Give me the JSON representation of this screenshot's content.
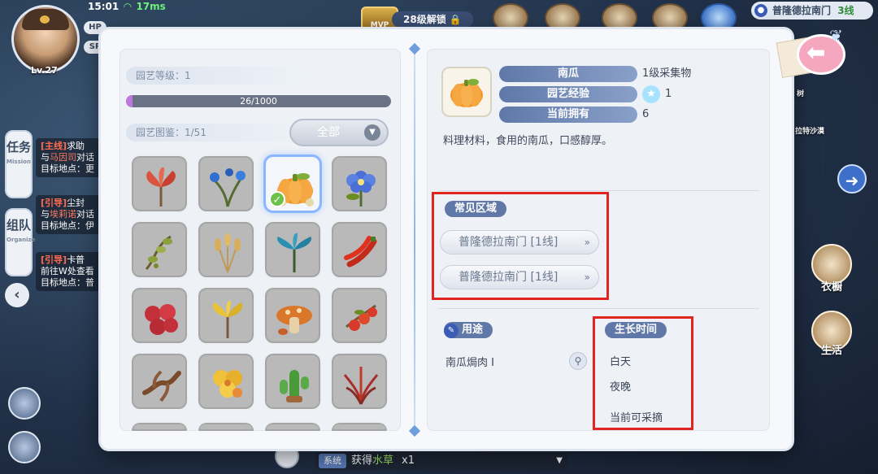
{
  "hud": {
    "time": "15:01",
    "ping": "17ms",
    "level": "Lv.27",
    "hp_label": "HP",
    "sp_label": "SP",
    "mvp_label": "MVP",
    "unlock_badge": "28级解锁",
    "location": "普隆德拉南门",
    "location_line": "3线",
    "mission_tab": "任务",
    "mission_sub": "Mission",
    "team_tab": "组队",
    "team_sub": "Organize",
    "quests": [
      {
        "tag": "[主线]",
        "title": "求助",
        "line2_pre": "与",
        "line2_hl": "马因司",
        "line2_post": "对话",
        "line3": "目标地点：更"
      },
      {
        "tag": "[引导]",
        "title": "尘封",
        "line2_pre": "与",
        "line2_hl": "埃莉诺",
        "line2_post": "对话",
        "line3": "目标地点：伊"
      },
      {
        "tag": "[引导]",
        "title": "卡普",
        "line2_pre": "前往W处查看",
        "line2_hl": "",
        "line2_post": "",
        "line3": "目标地点：普"
      }
    ],
    "side_labels": {
      "wardrobe": "衣橱",
      "life": "生活"
    },
    "map_labels": {
      "tree": "树",
      "desert": "拉特沙漠"
    },
    "chat": {
      "sys": "系统",
      "obtained": "获得",
      "item": "水草",
      "count": "x1"
    }
  },
  "left": {
    "level_label": "园艺等级：1",
    "xp_text": "26/1000",
    "xp_fraction": 0.026,
    "codex_label": "园艺图鉴：1/51",
    "filter_label": "全部",
    "plants": [
      "red-leaf-plant",
      "blue-flower-herb",
      "pumpkin",
      "blue-flower",
      "green-vine",
      "wheat",
      "blue-palm-leaf",
      "red-chili",
      "red-berry",
      "yellow-leaf",
      "orange-mushroom",
      "red-fruit-branch",
      "brown-root",
      "yellow-flower-cluster",
      "cactus",
      "red-grass"
    ],
    "selected_index": 2
  },
  "right": {
    "item_name_label": "南瓜",
    "item_name_value": "1级采集物",
    "exp_label": "园艺经验",
    "exp_value": "1",
    "owned_label": "当前拥有",
    "owned_value": "6",
    "description": "料理材料，食用的南瓜，口感醇厚。",
    "area_title": "常见区域",
    "areas": [
      "普隆德拉南门 [1线]",
      "普隆德拉南门 [1线]"
    ],
    "use_title": "用途",
    "use_item": "南瓜焗肉 I",
    "growth_title": "生长时间",
    "growth_times": [
      "白天",
      "夜晚",
      "当前可采摘"
    ]
  },
  "colors": {
    "highlight_box": "#e0241f",
    "accent_blue": "#5f78a8",
    "xp_fill": "#c078e0"
  }
}
